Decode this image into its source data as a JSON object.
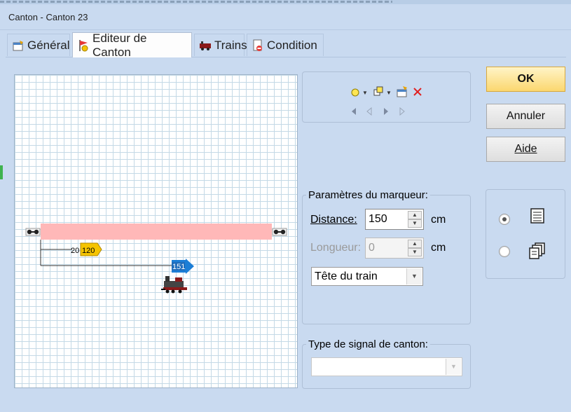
{
  "window": {
    "title": "Canton - Canton 23"
  },
  "tabs": [
    {
      "label": "Général",
      "icon": "general-properties-icon"
    },
    {
      "label": "Editeur de Canton",
      "icon": "block-editor-icon"
    },
    {
      "label": "Trains",
      "icon": "train-icon"
    },
    {
      "label": "Condition",
      "icon": "condition-icon"
    }
  ],
  "editor": {
    "marker_1": {
      "distance": "20",
      "speed": "120"
    },
    "marker_2": {
      "value": "151"
    },
    "colors": {
      "block": "#ffb8b8",
      "speed_marker": "#f5c400",
      "stop_marker": "#1c7ed6"
    }
  },
  "toolbar": {
    "add_marker_icon": "yellow-circle-icon",
    "add_object_icon": "add-object-icon",
    "properties_icon": "properties-icon",
    "delete_icon": "delete-red-x-icon",
    "nav": [
      "first-arrow-icon",
      "prev-arrow-icon",
      "next-arrow-icon",
      "last-arrow-icon"
    ]
  },
  "marker_params": {
    "legend": "Paramètres du marqueur:",
    "distance_label": "Distance:",
    "distance_value": "150",
    "distance_unit": "cm",
    "length_label": "Longueur:",
    "length_value": "0",
    "length_unit": "cm",
    "reference": "Tête du train"
  },
  "signal": {
    "legend": "Type de signal de canton:",
    "value": ""
  },
  "buttons": {
    "ok": "OK",
    "cancel": "Annuler",
    "help": "Aide"
  },
  "view_options": [
    {
      "icon": "list-view-icon",
      "selected": true
    },
    {
      "icon": "copy-view-icon",
      "selected": false
    }
  ]
}
